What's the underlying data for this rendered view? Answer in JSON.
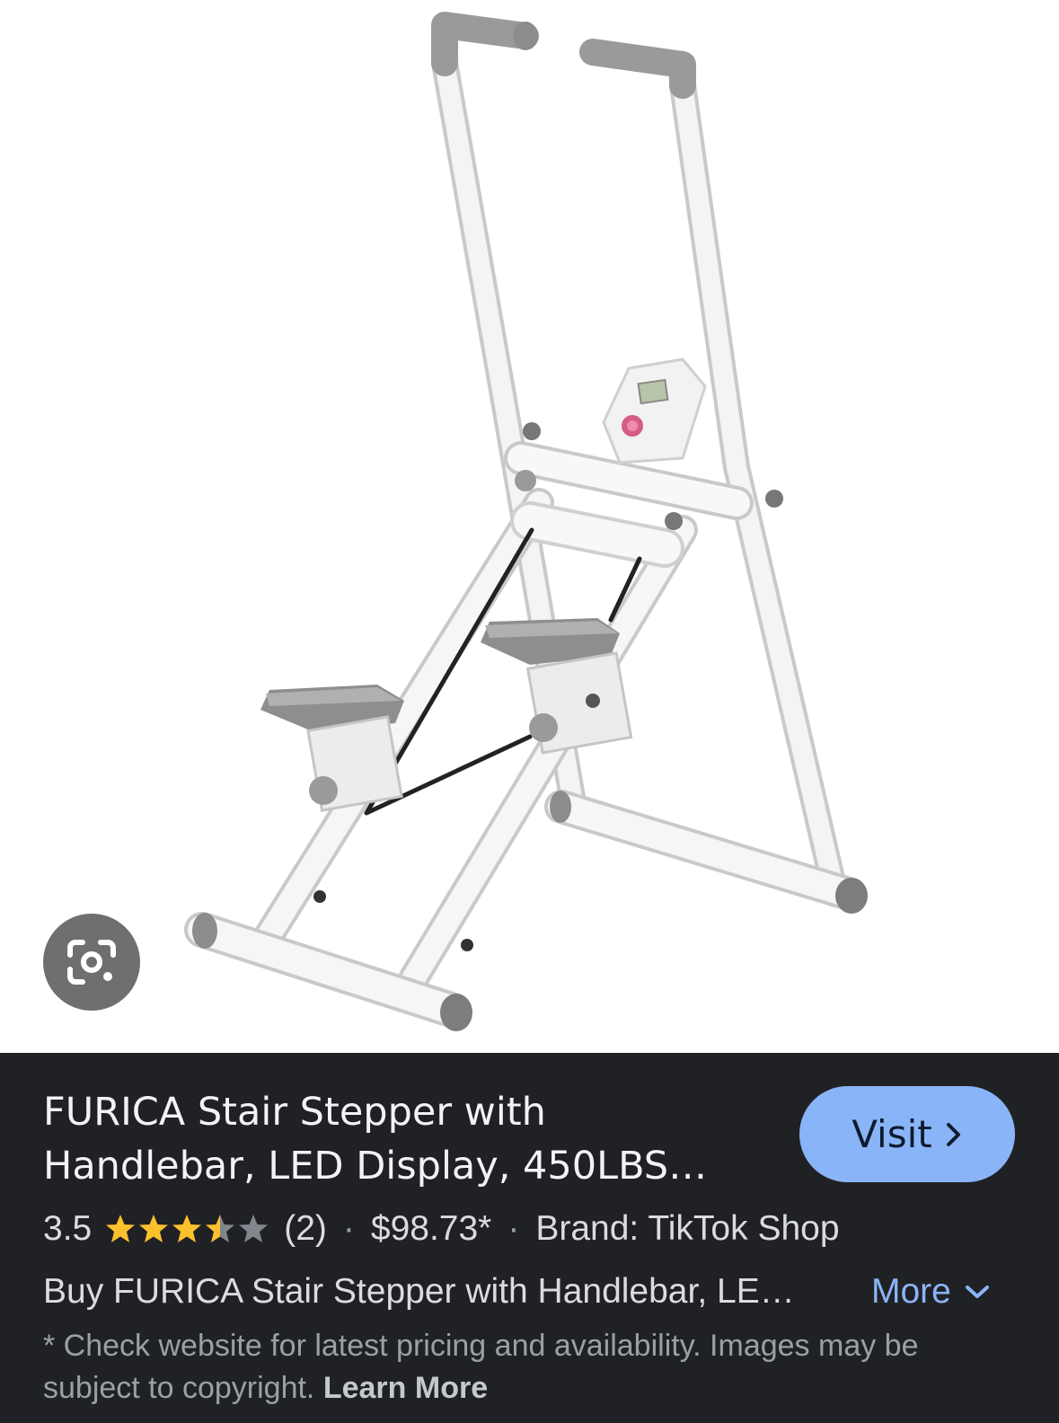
{
  "product": {
    "title": "FURICA Stair Stepper with Handlebar, LED Display, 450LBS…",
    "rating": "3.5",
    "stars_filled": 3.5,
    "stars_total": 5,
    "review_count": "(2)",
    "price": "$98.73*",
    "brand": "Brand: TikTok Shop",
    "description": "Buy FURICA Stair Stepper with Handlebar, LE…"
  },
  "actions": {
    "visit_label": "Visit",
    "more_label": "More"
  },
  "disclaimer": {
    "text": "* Check website for latest pricing and availability. Images may be subject to copyright.",
    "link": "Learn More"
  },
  "colors": {
    "panel_bg": "#202124",
    "visit_bg": "#8ab4f8",
    "link": "#8ab4f8",
    "star": "#fbc02d"
  },
  "icons": {
    "lens": "google-lens-icon",
    "visit": "chevron-right-icon",
    "more": "chevron-down-icon"
  }
}
